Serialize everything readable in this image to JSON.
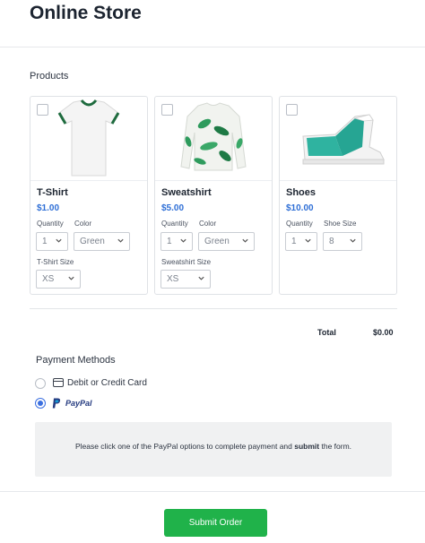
{
  "header": {
    "title": "Online Store"
  },
  "products_section": {
    "label": "Products"
  },
  "products": [
    {
      "name": "T-Shirt",
      "price": "$1.00",
      "image_icon": "tshirt-icon",
      "options": [
        {
          "label": "Quantity",
          "value": "1"
        },
        {
          "label": "Color",
          "value": "Green"
        },
        {
          "label": "T-Shirt Size",
          "value": "XS"
        }
      ]
    },
    {
      "name": "Sweatshirt",
      "price": "$5.00",
      "image_icon": "sweatshirt-icon",
      "options": [
        {
          "label": "Quantity",
          "value": "1"
        },
        {
          "label": "Color",
          "value": "Green"
        },
        {
          "label": "Sweatshirt Size",
          "value": "XS"
        }
      ]
    },
    {
      "name": "Shoes",
      "price": "$10.00",
      "image_icon": "sneaker-icon",
      "options": [
        {
          "label": "Quantity",
          "value": "1"
        },
        {
          "label": "Shoe Size",
          "value": "8"
        }
      ]
    }
  ],
  "total": {
    "label": "Total",
    "value": "$0.00"
  },
  "payment": {
    "title": "Payment Methods",
    "methods": [
      {
        "label": "Debit or Credit Card",
        "selected": false
      },
      {
        "label": "PayPal",
        "selected": true
      }
    ],
    "notice_before": "Please click one of the PayPal options to complete payment and ",
    "notice_bold": "submit",
    "notice_after": " the form."
  },
  "submit": {
    "label": "Submit Order"
  },
  "colors": {
    "accent": "#2f6fd6",
    "submit": "#20b24a",
    "product_green": "#1e7a45",
    "shoe_teal": "#2fb3a0"
  }
}
